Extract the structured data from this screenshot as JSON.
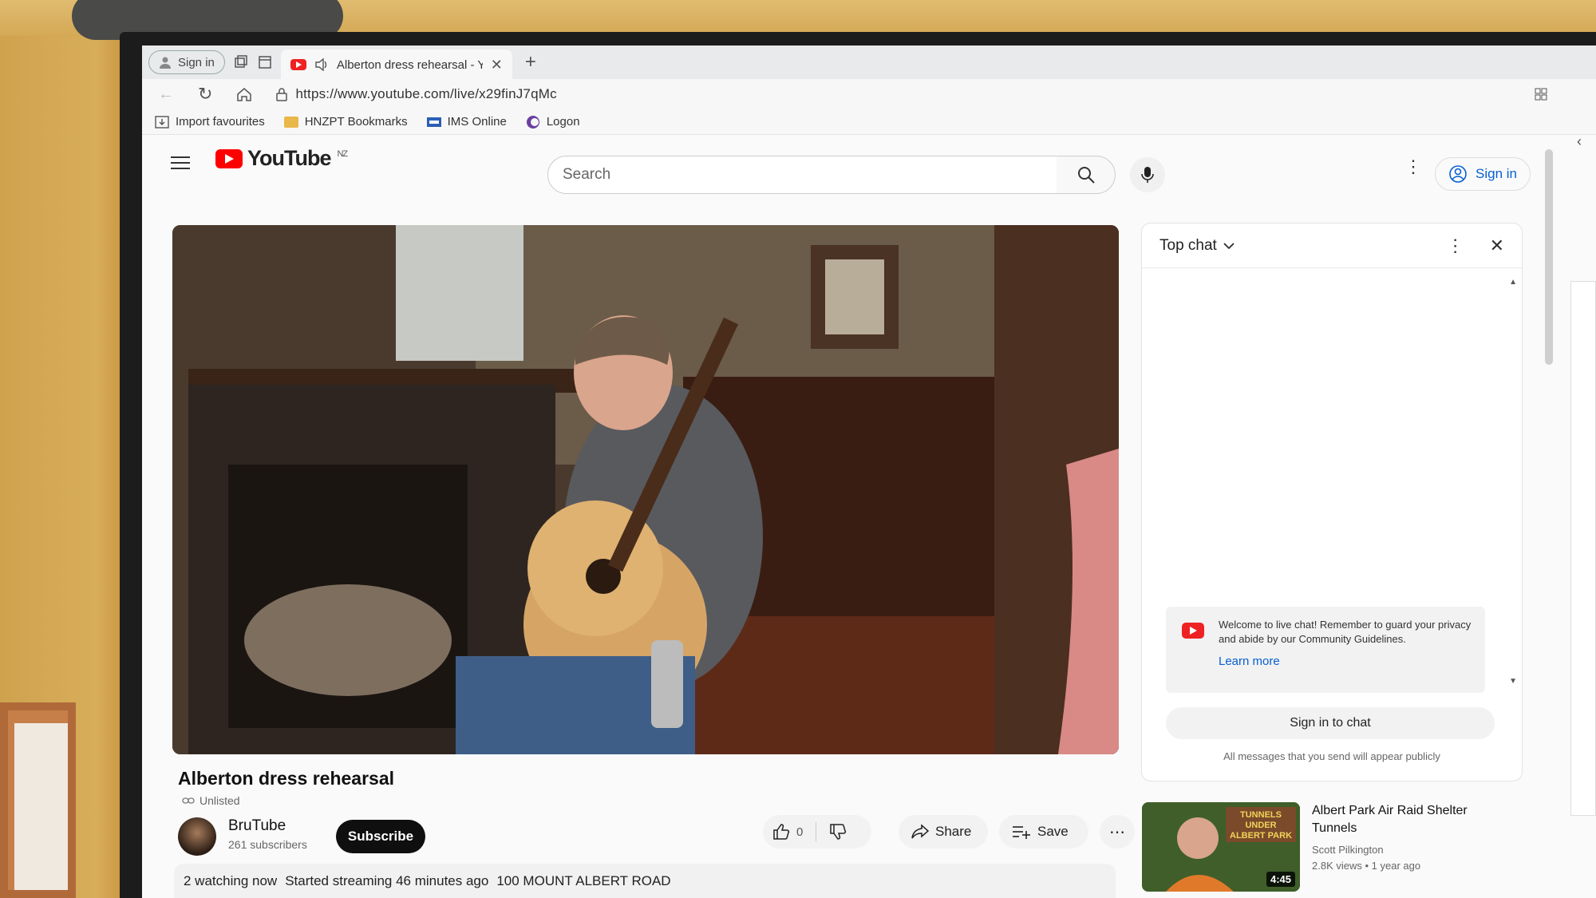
{
  "browser": {
    "profile_label": "Sign in",
    "tab_title": "Alberton dress rehearsal - Y",
    "url": "https://www.youtube.com/live/x29finJ7qMc",
    "bookmarks": [
      "Import favourites",
      "HNZPT Bookmarks",
      "IMS Online",
      "Logon"
    ]
  },
  "youtube": {
    "logo_text": "YouTube",
    "region": "NZ",
    "search_placeholder": "Search",
    "sign_in": "Sign in"
  },
  "video": {
    "title": "Alberton dress rehearsal",
    "visibility": "Unlisted",
    "channel": "BruTube",
    "subscribers": "261 subscribers",
    "subscribe_label": "Subscribe",
    "likes": "0",
    "share_label": "Share",
    "save_label": "Save",
    "watching": "2 watching now",
    "started": "Started streaming 46 minutes ago",
    "location": "100 MOUNT ALBERT ROAD"
  },
  "chat": {
    "mode": "Top chat",
    "welcome": "Welcome to live chat! Remember to guard your privacy and abide by our Community Guidelines.",
    "learn_more": "Learn more",
    "sign_in_chat": "Sign in to chat",
    "public_notice": "All messages that you send will appear publicly"
  },
  "recommended": [
    {
      "title": "Albert Park Air Raid Shelter Tunnels",
      "channel": "Scott Pilkington",
      "meta": "2.8K views • 1 year ago",
      "duration": "4:45",
      "thumb_text": "TUNNELS UNDER ALBERT PARK"
    }
  ],
  "colors": {
    "youtube_red": "#ff0000",
    "link_blue": "#065fd4",
    "subscribe_bg": "#0f0f0f"
  }
}
